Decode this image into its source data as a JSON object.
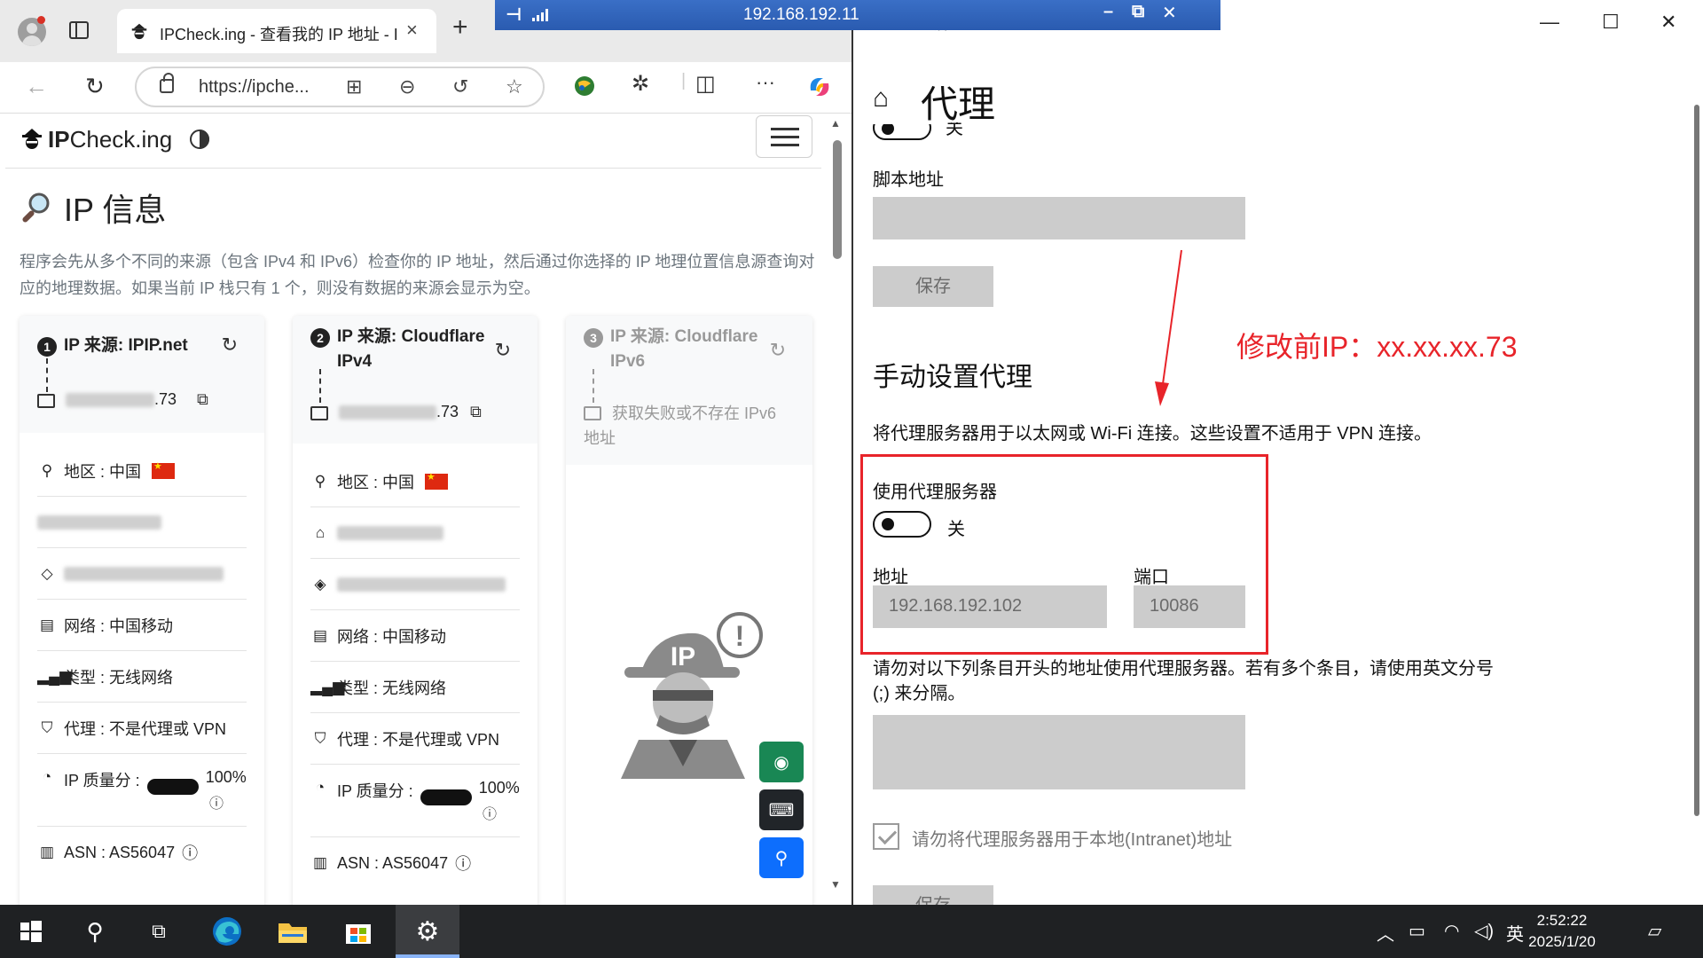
{
  "browser": {
    "tab_title": "IPCheck.ing - 查看我的 IP 地址 - I",
    "tab_close": "×",
    "new_tab": "+",
    "url": "https://ipche...",
    "site": {
      "logo_bold": "IP",
      "logo_rest": "Check.ing",
      "page_title": "IP 信息",
      "intro": "程序会先从多个不同的来源（包含 IPv4 和 IPv6）检查你的 IP 地址，然后通过你选择的 IP 地理位置信息源查询对应的地理数据。如果当前 IP 栈只有 1 个，则没有数据的来源会显示为空。"
    },
    "cards": [
      {
        "num": "1",
        "title": "IP 来源: IPIP.net",
        "ip_suffix": ".73",
        "region": "地区 : 中国",
        "network": "网络 : 中国移动",
        "type": "类型 : 无线网络",
        "proxy": "代理 : 不是代理或 VPN",
        "quality_label": "IP 质量分 :",
        "quality_value": "100%",
        "asn": "ASN : AS56047"
      },
      {
        "num": "2",
        "title": "IP 来源: Cloudflare IPv4",
        "ip_suffix": ".73",
        "region": "地区 : 中国",
        "network": "网络 : 中国移动",
        "type": "类型 : 无线网络",
        "proxy": "代理 : 不是代理或 VPN",
        "quality_label": "IP 质量分 :",
        "quality_value": "100%",
        "asn": "ASN : AS56047"
      },
      {
        "num": "3",
        "title": "IP 来源: Cloudflare IPv6",
        "fail": "获取失败或不存在 IPv6 地址"
      }
    ]
  },
  "remote": {
    "rdp_title": "192.168.192.11",
    "under_title": "设置",
    "settings_title": "代理",
    "toggle_top_label": "关",
    "script_address_label": "脚本地址",
    "save_label": "保存",
    "annotation": "修改前IP：xx.xx.xx.73",
    "manual_title": "手动设置代理",
    "manual_desc": "将代理服务器用于以太网或 Wi-Fi 连接。这些设置不适用于 VPN 连接。",
    "use_proxy_label": "使用代理服务器",
    "use_proxy_state": "关",
    "address_label": "地址",
    "address_value": "192.168.192.102",
    "port_label": "端口",
    "port_value": "10086",
    "exceptions_desc": "请勿对以下列条目开头的地址使用代理服务器。若有多个条目，请使用英文分号 (;) 来分隔。",
    "local_checkbox_label": "请勿将代理服务器用于本地(Intranet)地址",
    "save_bottom_label": "保存"
  },
  "taskbar": {
    "ime": "英",
    "time": "2:52:22",
    "date": "2025/1/20"
  },
  "colors": {
    "accent_red": "#e8242a",
    "fab_green": "#198754",
    "fab_dark": "#212529",
    "fab_blue": "#0d6efd",
    "rdp_blue": "#2a5bb0",
    "taskbar": "#1f2123"
  }
}
